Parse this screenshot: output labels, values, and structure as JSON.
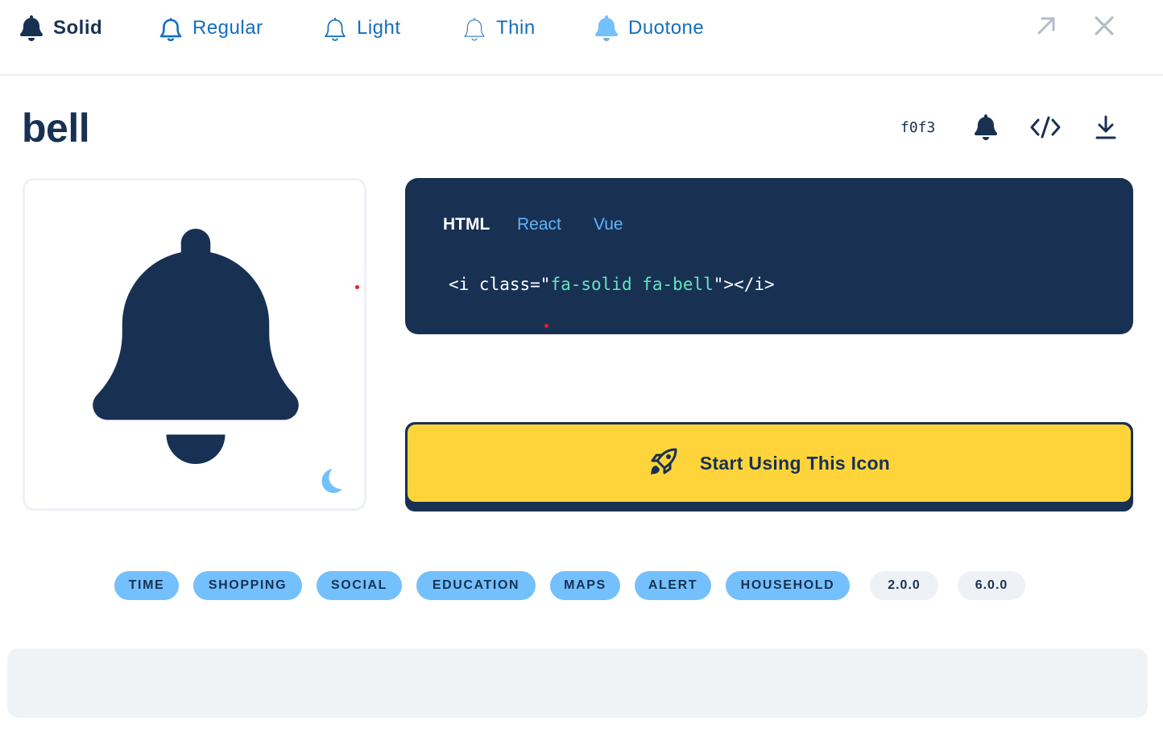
{
  "style_tabs": [
    {
      "label": "Solid",
      "icon": "bell-solid-icon",
      "active": true
    },
    {
      "label": "Regular",
      "icon": "bell-regular-icon",
      "active": false
    },
    {
      "label": "Light",
      "icon": "bell-light-icon",
      "active": false
    },
    {
      "label": "Thin",
      "icon": "bell-thin-icon",
      "active": false
    },
    {
      "label": "Duotone",
      "icon": "bell-duotone-icon",
      "active": false
    }
  ],
  "top_actions": {
    "expand_icon": "arrow-up-right-icon",
    "close_icon": "close-icon"
  },
  "icon": {
    "name": "bell",
    "unicode": "f0f3"
  },
  "meta_actions": {
    "glyph_icon": "bell-glyph-icon",
    "code_icon": "code-icon",
    "download_icon": "download-icon"
  },
  "code_panel": {
    "tabs": [
      {
        "label": "HTML",
        "active": true
      },
      {
        "label": "React",
        "active": false
      },
      {
        "label": "Vue",
        "active": false
      }
    ],
    "snippet": {
      "open": "<i class=",
      "quote_open": "\"",
      "class_value": "fa-solid fa-bell",
      "quote_close": "\"",
      "close": "></i>"
    }
  },
  "preview": {
    "theme_toggle_icon": "moon-icon"
  },
  "cta": {
    "label": "Start Using This Icon",
    "icon": "rocket-icon"
  },
  "tags": [
    "TIME",
    "SHOPPING",
    "SOCIAL",
    "EDUCATION",
    "MAPS",
    "ALERT",
    "HOUSEHOLD"
  ],
  "versions": [
    "2.0.0",
    "6.0.0"
  ],
  "colors": {
    "navy": "#183153",
    "blue": "#146ebe",
    "light_blue": "#74c0fc",
    "yellow": "#ffd43b",
    "code_string": "#63e6be",
    "code_tab": "#63b3f7"
  }
}
